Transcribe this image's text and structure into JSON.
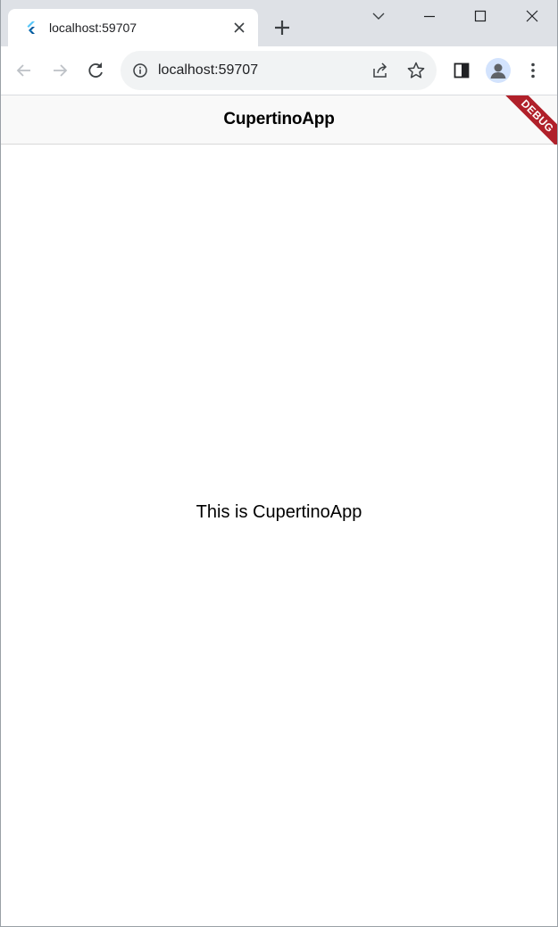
{
  "browser": {
    "tab": {
      "title": "localhost:59707",
      "favicon": "flutter-logo-icon"
    },
    "omnibox": {
      "url": "localhost:59707"
    },
    "icons": {
      "back": "arrow-left-icon",
      "forward": "arrow-right-icon",
      "reload": "reload-icon",
      "info": "info-icon",
      "share": "share-icon",
      "bookmark": "star-icon",
      "side_panel": "side-panel-icon",
      "profile": "avatar-icon",
      "menu": "more-vertical-icon"
    }
  },
  "app": {
    "nav_title": "CupertinoApp",
    "body_text": "This is CupertinoApp",
    "debug_banner": "DEBUG",
    "colors": {
      "nav_background": "#f9f9f9",
      "banner": "#b0202a"
    }
  }
}
